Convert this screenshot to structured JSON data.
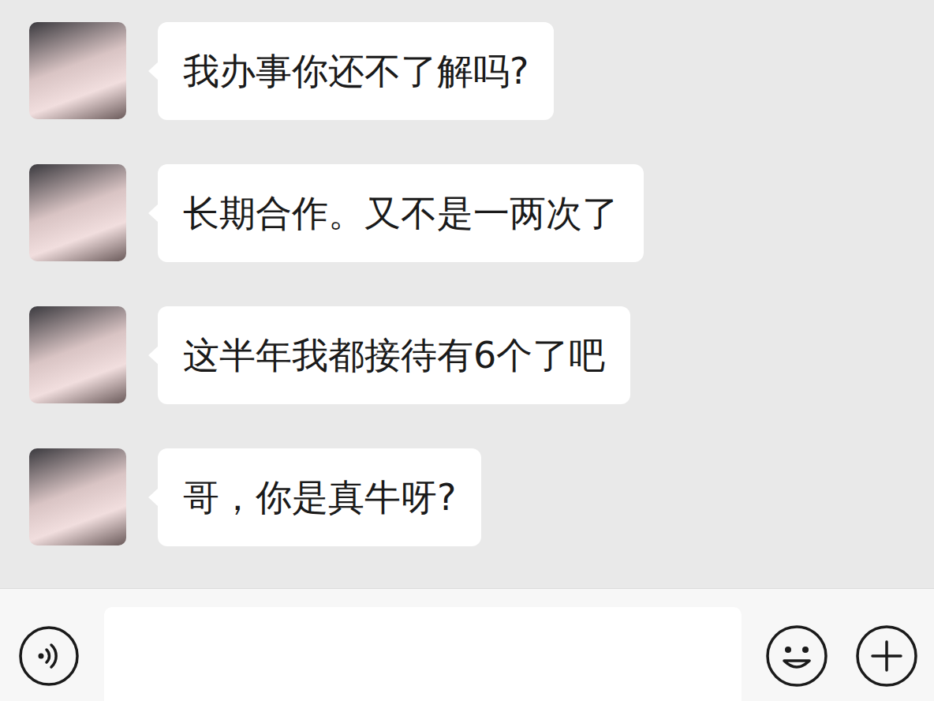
{
  "chat": {
    "messages": [
      {
        "sender": "other",
        "text": "我办事你还不了解吗?"
      },
      {
        "sender": "other",
        "text": "长期合作。又不是一两次了"
      },
      {
        "sender": "other",
        "text": "这半年我都接待有6个了吧"
      },
      {
        "sender": "other",
        "text": "哥，你是真牛呀?"
      }
    ]
  },
  "input_bar": {
    "value": ""
  }
}
